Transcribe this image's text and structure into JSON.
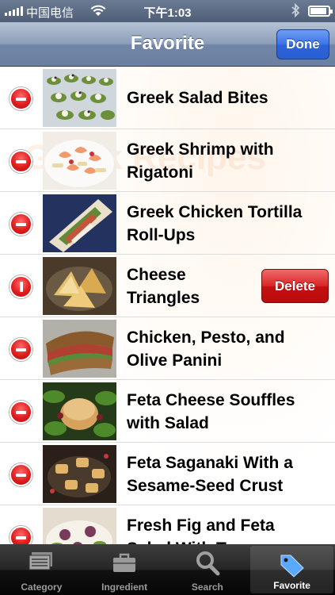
{
  "status_bar": {
    "carrier": "中国电信",
    "time": "下午1:03",
    "icons": [
      "signal-icon",
      "wifi-icon",
      "bluetooth-icon",
      "battery-icon"
    ]
  },
  "nav": {
    "title": "Favorite",
    "done_label": "Done"
  },
  "list": {
    "watermark": "Greek Recipes",
    "items": [
      {
        "title": "Greek Salad Bites"
      },
      {
        "title": "Greek Shrimp with Rigatoni"
      },
      {
        "title": "Greek Chicken Tortilla Roll-Ups"
      },
      {
        "title": "Cheese Triangles",
        "delete_label": "Delete"
      },
      {
        "title": "Chicken, Pesto, and Olive Panini"
      },
      {
        "title": "Feta Cheese Souffles with Salad"
      },
      {
        "title": "Feta Saganaki With a Sesame-Seed Crust"
      },
      {
        "title": "Fresh Fig and Feta Salad With Tarragon"
      }
    ]
  },
  "tabs": [
    {
      "label": "Category",
      "icon": "category-icon"
    },
    {
      "label": "Ingredient",
      "icon": "briefcase-icon"
    },
    {
      "label": "Search",
      "icon": "search-icon"
    },
    {
      "label": "Favorite",
      "icon": "tag-icon",
      "active": true
    }
  ],
  "colors": {
    "nav_bar": "#7d90ae",
    "done_button": "#3c73e4",
    "delete_button": "#d92626",
    "minus_badge": "#e11d1d",
    "tab_bar": "#1a1a1a"
  }
}
